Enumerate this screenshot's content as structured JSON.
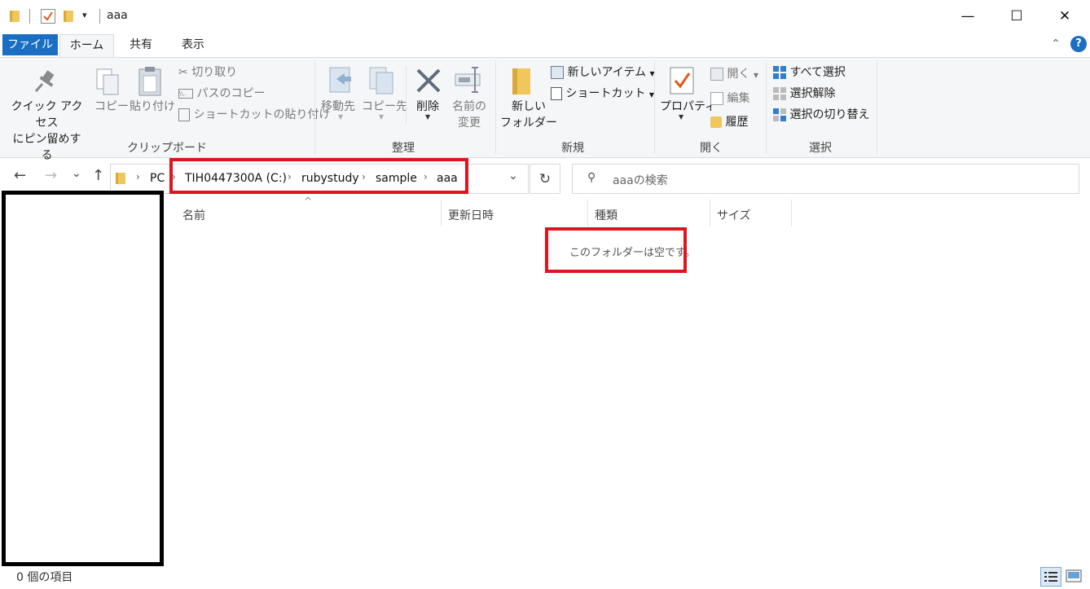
{
  "window": {
    "title": "aaa",
    "quick_access_dropdown": "▾",
    "minimize": "—",
    "maximize": "☐",
    "close": "✕"
  },
  "tabs": {
    "file": "ファイル",
    "home": "ホーム",
    "share": "共有",
    "view": "表示"
  },
  "ribbon": {
    "clipboard": {
      "pin_line1": "クイック アクセス",
      "pin_line2": "にピン留めする",
      "copy": "コピー",
      "paste": "貼り付け",
      "cut": "切り取り",
      "copy_path": "パスのコピー",
      "paste_shortcut": "ショートカットの貼り付け",
      "label": "クリップボード"
    },
    "organize": {
      "move_to": "移動先",
      "copy_to": "コピー先",
      "delete": "削除",
      "rename_line1": "名前の",
      "rename_line2": "変更",
      "label": "整理"
    },
    "new": {
      "new_folder_line1": "新しい",
      "new_folder_line2": "フォルダー",
      "new_item": "新しいアイテム",
      "shortcut": "ショートカット",
      "label": "新規"
    },
    "open": {
      "properties": "プロパティ",
      "open": "開く",
      "edit": "編集",
      "history": "履歴",
      "label": "開く"
    },
    "select": {
      "select_all": "すべて選択",
      "select_none": "選択解除",
      "invert_selection": "選択の切り替え",
      "label": "選択"
    }
  },
  "address": {
    "back": "←",
    "forward": "→",
    "recent": "⌄",
    "up": "↑",
    "crumbs": [
      "PC",
      "TIH0447300A (C:)",
      "rubystudy",
      "sample",
      "aaa"
    ],
    "refresh": "↻",
    "search_placeholder": "aaaの検索"
  },
  "columns": {
    "name": "名前",
    "date": "更新日時",
    "type": "種類",
    "size": "サイズ",
    "sort_indicator": "^"
  },
  "content": {
    "empty_message": "このフォルダーは空です。"
  },
  "status": {
    "item_count": "0 個の項目"
  },
  "colors": {
    "accent": "#1a6fc3",
    "highlight_box": "#e0131e",
    "ribbon_bg": "#f5f6f7"
  }
}
